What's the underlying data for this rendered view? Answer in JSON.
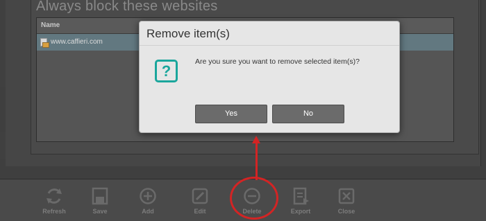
{
  "section": {
    "title": "Always block these websites"
  },
  "list": {
    "header": "Name",
    "rows": [
      {
        "url": "www.caffieri.com"
      }
    ]
  },
  "toolbar": {
    "items": [
      {
        "label": "Refresh",
        "icon": "refresh-icon"
      },
      {
        "label": "Save",
        "icon": "save-icon"
      },
      {
        "label": "Add",
        "icon": "add-icon"
      },
      {
        "label": "Edit",
        "icon": "edit-icon"
      },
      {
        "label": "Delete",
        "icon": "delete-icon"
      },
      {
        "label": "Export",
        "icon": "export-icon"
      },
      {
        "label": "Close",
        "icon": "close-icon"
      }
    ]
  },
  "dialog": {
    "title": "Remove item(s)",
    "icon": "question-icon",
    "icon_glyph": "?",
    "message": "Are you sure you want to remove selected item(s)?",
    "yes_label": "Yes",
    "no_label": "No"
  },
  "colors": {
    "accent": "#1aa69c",
    "annotation": "#d32424",
    "selection": "#627880"
  }
}
